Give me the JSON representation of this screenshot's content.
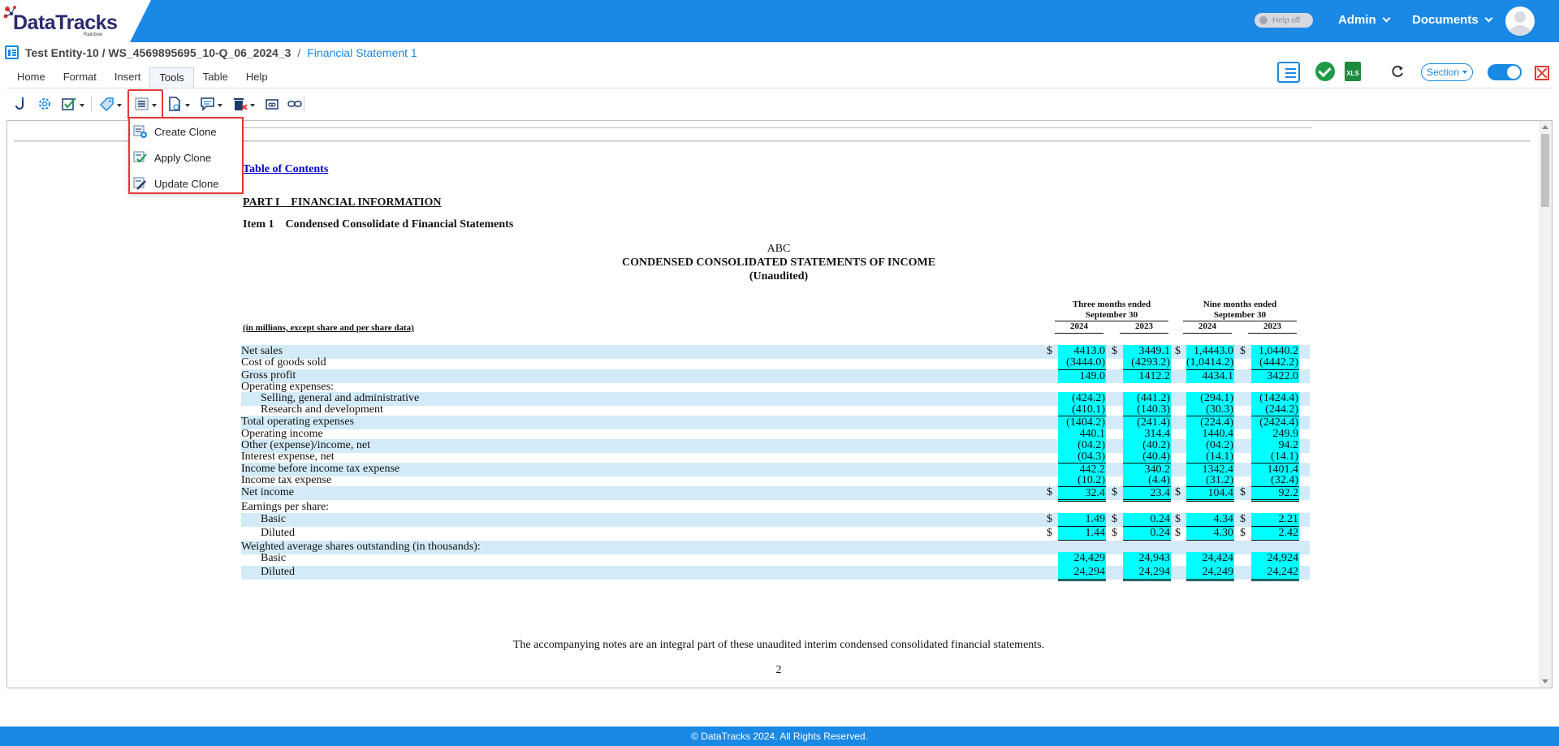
{
  "app": {
    "brand": "DataTracks",
    "brand_sub": "Rainbow",
    "help_toggle": "Help off",
    "menus": [
      "Admin",
      "Documents"
    ]
  },
  "breadcrumb": {
    "entity": "Test Entity-10 / WS_4569895695_10-Q_06_2024_3",
    "separator": "/",
    "current": "Financial Statement 1"
  },
  "ribbon": {
    "tabs": [
      "Home",
      "Format",
      "Insert",
      "Tools",
      "Table",
      "Help"
    ],
    "active_tab": "Tools"
  },
  "right_tools": {
    "section_label": "Section",
    "xls_label": "XLS"
  },
  "clone_menu": {
    "items": [
      "Create Clone",
      "Apply Clone",
      "Update Clone"
    ]
  },
  "document": {
    "toc_link": "Table of Contents",
    "part": "PART I    FINANCIAL INFORMATION",
    "item": "Item 1    Condensed Consolidate d Financial Statements",
    "company": "ABC",
    "statement_title": "CONDENSED CONSOLIDATED STATEMENTS OF INCOME",
    "unaudited": "(Unaudited)",
    "units": "(in millions, except share and per share data)",
    "group_headers": [
      "Three months ended September 30",
      "Nine months ended September 30"
    ],
    "years": [
      "2024",
      "2023",
      "2024",
      "2023"
    ],
    "rows": [
      {
        "label": "Net sales",
        "values": [
          "4413.0",
          "3449.1",
          "1,4443.0",
          "1,0440.2"
        ],
        "dollar": true
      },
      {
        "label": "Cost of goods sold",
        "values": [
          "(3444.0)",
          "(4293.2)",
          "(1,0414.2)",
          "(4442.2)"
        ]
      },
      {
        "label": "Gross profit",
        "values": [
          "149.0",
          "1412.2",
          "4434.1",
          "3422.0"
        ]
      },
      {
        "label": "Operating expenses:",
        "values": []
      },
      {
        "label": "Selling, general and administrative",
        "values": [
          "(424.2)",
          "(441.2)",
          "(294.1)",
          "(1424.4)"
        ]
      },
      {
        "label": "Research and development",
        "values": [
          "(410.1)",
          "(140.3)",
          "(30.3)",
          "(244.2)"
        ]
      },
      {
        "label": "Total operating expenses",
        "values": [
          "(1404.2)",
          "(241.4)",
          "(224.4)",
          "(2424.4)"
        ]
      },
      {
        "label": "Operating income",
        "values": [
          "440.1",
          "314.4",
          "1440.4",
          "249.9"
        ]
      },
      {
        "label": "Other (expense)/income, net",
        "values": [
          "(04.2)",
          "(40.2)",
          "(04.2)",
          "94.2"
        ]
      },
      {
        "label": "Interest expense, net",
        "values": [
          "(04.3)",
          "(40.4)",
          "(14.1)",
          "(14.1)"
        ]
      },
      {
        "label": "Income before income tax expense",
        "values": [
          "442.2",
          "340.2",
          "1342.4",
          "1401.4"
        ]
      },
      {
        "label": "Income tax expense",
        "values": [
          "(10.2)",
          "(4.4)",
          "(31.2)",
          "(32.4)"
        ]
      },
      {
        "label": "Net income",
        "values": [
          "32.4",
          "23.4",
          "104.4",
          "92.2"
        ],
        "dollar": true
      },
      {
        "label": "Earnings per share:",
        "values": []
      },
      {
        "label": "Basic",
        "values": [
          "1.49",
          "0.24",
          "4.34",
          "2.21"
        ],
        "dollar": true
      },
      {
        "label": "Diluted",
        "values": [
          "1.44",
          "0.24",
          "4.30",
          "2.42"
        ],
        "dollar": true
      },
      {
        "label": "Weighted average shares outstanding (in thousands):",
        "values": []
      },
      {
        "label": "Basic",
        "values": [
          "24,429",
          "24,943",
          "24,424",
          "24,924"
        ]
      },
      {
        "label": "Diluted",
        "values": [
          "24,294",
          "24,294",
          "24,249",
          "24,242"
        ]
      }
    ],
    "dollar_sign": "$",
    "footnote": "The accompanying notes are an integral part of these unaudited interim condensed consolidated financial statements.",
    "page_number": "2"
  },
  "footer": {
    "copyright": "© DataTracks 2024. All Rights Reserved."
  }
}
